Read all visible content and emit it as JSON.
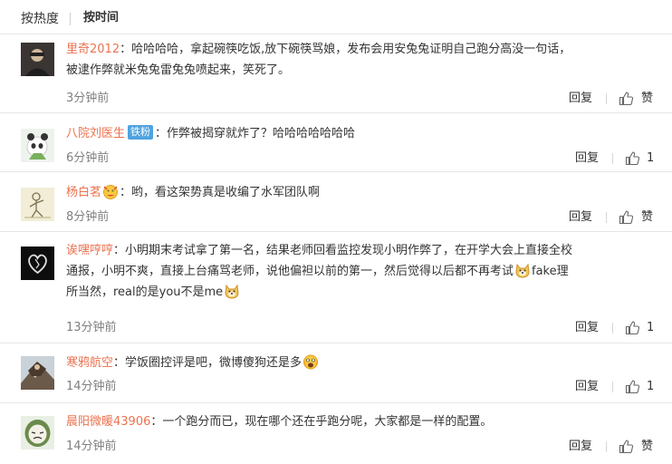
{
  "sort": {
    "hot": "按热度",
    "time": "按时间"
  },
  "comments": [
    {
      "user": "里奇2012",
      "lines": [
        "：哈哈哈哈，拿起碗筷吃饭,放下碗筷骂娘，发布会用安兔兔证明自己跑分高没一句话，",
        "被逮作弊就米兔兔雷兔兔喷起来，笑死了。"
      ],
      "time": "3分钟前",
      "reply": "回复",
      "like": "赞"
    },
    {
      "user": "八院刘医生",
      "badge": "铁粉",
      "lines": [
        "：作弊被揭穿就炸了？哈哈哈哈哈哈哈"
      ],
      "time": "6分钟前",
      "reply": "回复",
      "like": "1"
    },
    {
      "user": "杨白茗",
      "lines": [
        "：哟，看这架势真是收编了水军团队啊"
      ],
      "time": "8分钟前",
      "reply": "回复",
      "like": "赞"
    },
    {
      "user": "诶嘿哼哼",
      "lines": [
        "：小明期末考试拿了第一名，结果老师回看监控发现小明作弊了，在开学大会上直接全校",
        "通报，小明不爽，直接上台痛骂老师，说他偏袒以前的第一，然后觉得以后都不再考试",
        "fake理",
        "所当然，real的是you不是me"
      ],
      "time": "13分钟前",
      "reply": "回复",
      "like": "1"
    },
    {
      "user": "寒鸦航空",
      "lines": [
        "：学饭圈控评是吧，微博傻狗还是多"
      ],
      "time": "14分钟前",
      "reply": "回复",
      "like": "1"
    },
    {
      "user": "晨阳微暖43906",
      "lines": [
        "：一个跑分而已，现在哪个还在乎跑分呢，大家都是一样的配置。"
      ],
      "time": "14分钟前",
      "reply": "回复",
      "like": "赞"
    }
  ],
  "emoji_icons": [
    "smile-icon",
    "doge-icon",
    "doge-icon",
    "fear-icon"
  ],
  "colors": {
    "username": "#eb7350",
    "badge": "#4fa3e0",
    "time": "#808080",
    "divider": "#e6e6e6"
  }
}
